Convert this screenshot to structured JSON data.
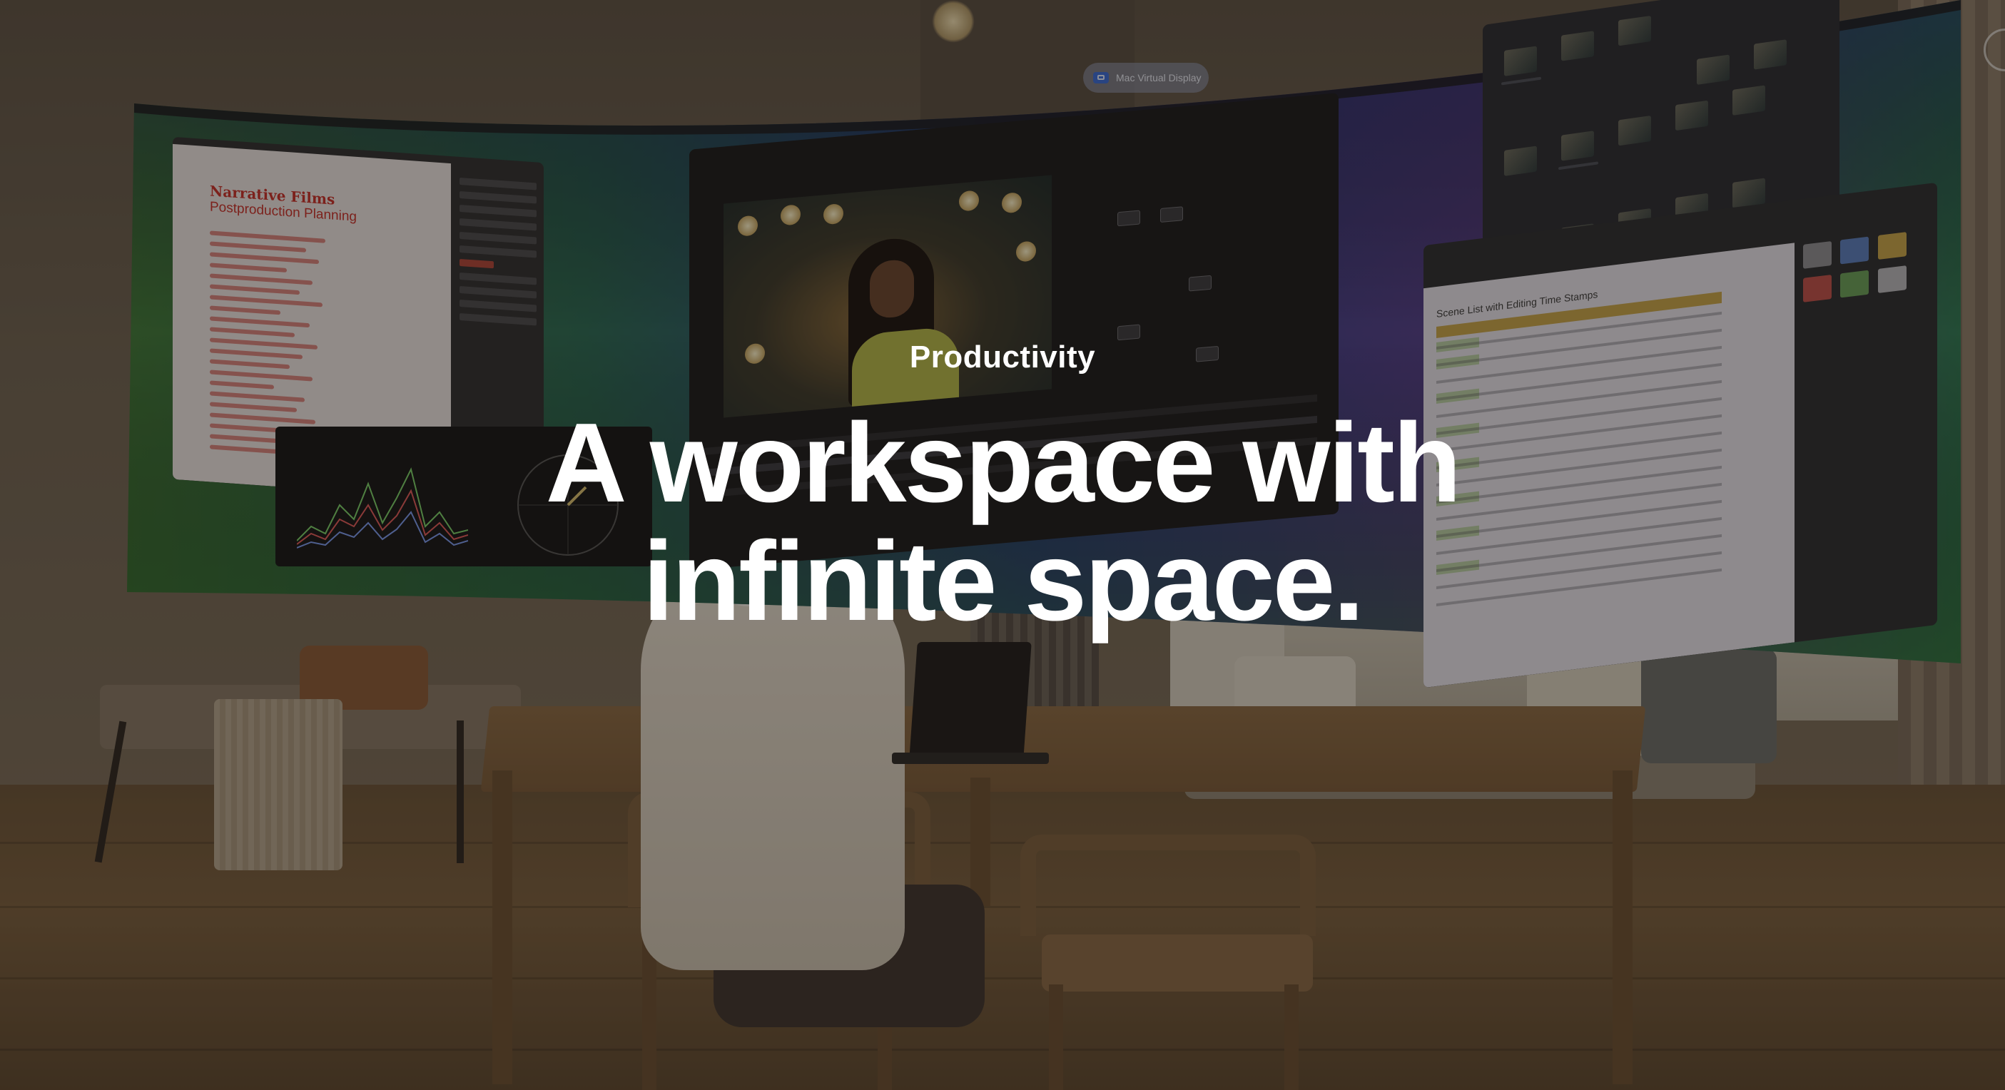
{
  "hero": {
    "eyebrow": "Productivity",
    "headline_line1": "A workspace with",
    "headline_line2": "infinite space."
  },
  "virtual_display": {
    "chip_label": "Mac Virtual Display",
    "chip_icon": "display-icon"
  },
  "document_window": {
    "title": "Narrative Films",
    "subtitle": "Postproduction Planning"
  },
  "spreadsheet_window": {
    "title": "Scene List with Editing Time Stamps"
  },
  "colors": {
    "text": "#ffffff",
    "doc_accent": "#c8302a",
    "sheet_header": "#c9a54a",
    "display_green": "#3f7a3a",
    "display_blue": "#2a3e8a",
    "display_purple": "#5a3f8c"
  }
}
